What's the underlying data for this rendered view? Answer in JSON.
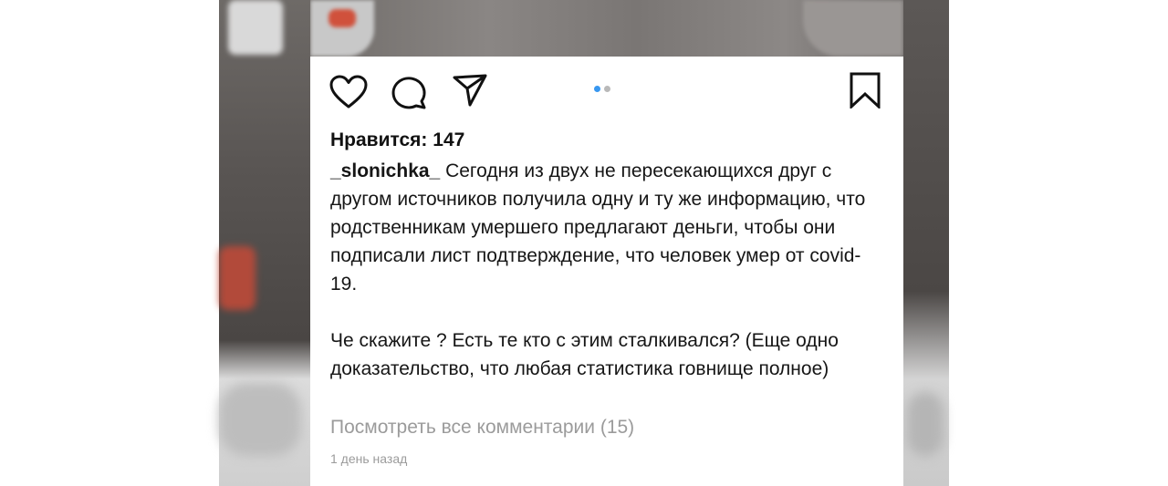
{
  "post": {
    "likes_text": "Нравится: 147",
    "username": "_slonichka_",
    "caption_paragraph1": " Сегодня из двух не пересекающихся друг с другом источников получила одну и ту же информацию, что родственникам умершего предлагают деньги, чтобы они подписали лист подтверждение, что человек умер от covid-19.",
    "caption_paragraph2": "Че скажите ? Есть те кто с этим сталкивался? (Еще одно доказательство, что любая статистика говнище полное)",
    "view_comments": "Посмотреть все комментарии (15)",
    "timestamp": "1 день назад"
  },
  "carousel": {
    "total_dots": 2,
    "active_index": 0,
    "active_color": "#3897f0",
    "inactive_color": "#b9b9b9"
  },
  "icons": {
    "like": "heart-icon",
    "comment": "comment-icon",
    "share": "send-icon",
    "save": "bookmark-icon"
  }
}
